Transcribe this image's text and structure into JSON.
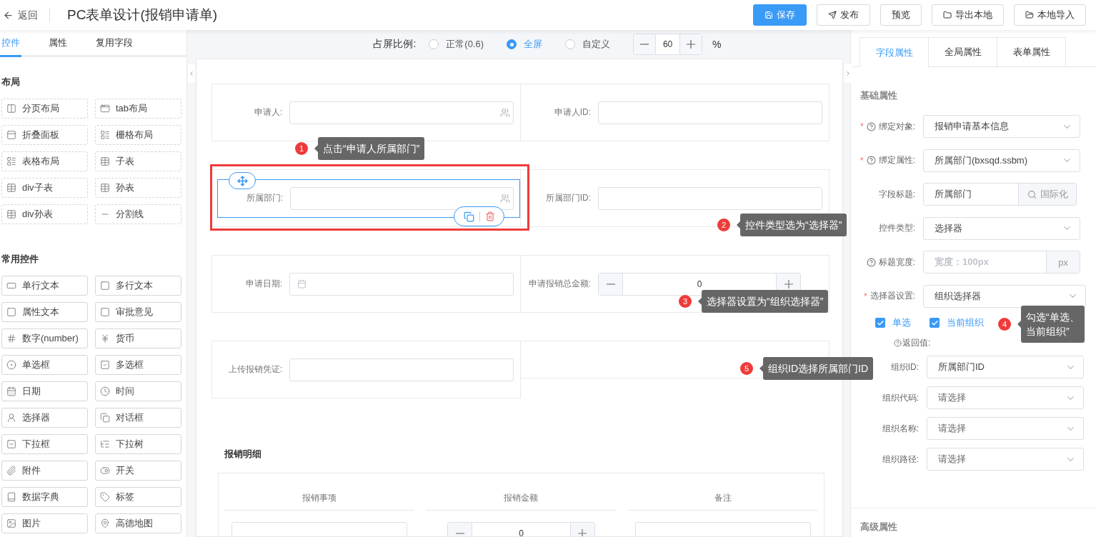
{
  "header": {
    "back": "返回",
    "title": "PC表单设计(报销申请单)",
    "buttons": [
      {
        "label": "保存",
        "kind": "primary"
      },
      {
        "label": "发布",
        "kind": "publish"
      },
      {
        "label": "预览",
        "kind": "plain"
      },
      {
        "label": "导出本地",
        "kind": "export"
      },
      {
        "label": "本地导入",
        "kind": "import"
      }
    ]
  },
  "left_panel": {
    "tabs": [
      {
        "label": "控件",
        "selected": true
      },
      {
        "label": "属性",
        "selected": false
      },
      {
        "label": "复用字段",
        "selected": false
      }
    ],
    "sections": [
      {
        "title": "布局",
        "kind": "layout",
        "items": [
          "分页布局",
          "tab布局",
          "折叠面板",
          "栅格布局",
          "表格布局",
          "子表",
          "div子表",
          "孙表",
          "div孙表",
          "分割线"
        ]
      },
      {
        "title": "常用控件",
        "kind": "common",
        "items": [
          "单行文本",
          "多行文本",
          "属性文本",
          "审批意见",
          "数字(number)",
          "货币",
          "单选框",
          "多选框",
          "日期",
          "时间",
          "选择器",
          "对话框",
          "下拉框",
          "下拉树",
          "附件",
          "开关",
          "数据字典",
          "标签",
          "图片",
          "高德地图"
        ]
      }
    ]
  },
  "ratio_bar": {
    "label": "占屏比例:",
    "options": [
      {
        "label": "正常(0.6)",
        "selected": false
      },
      {
        "label": "全屏",
        "selected": true
      },
      {
        "label": "自定义",
        "selected": false
      }
    ],
    "value": "60",
    "unit": "%"
  },
  "form": {
    "rows": [
      {
        "selected": false,
        "cells": [
          {
            "label": "申请人:",
            "kind": "user"
          },
          {
            "label": "申请人ID:",
            "kind": "text"
          }
        ]
      },
      {
        "selected": true,
        "cells": [
          {
            "label": "所属部门:",
            "kind": "user"
          },
          {
            "label": "所属部门ID:",
            "kind": "text"
          }
        ]
      },
      {
        "selected": false,
        "cells": [
          {
            "label": "申请日期:",
            "kind": "date"
          },
          {
            "label": "申请报销总金额:",
            "kind": "number",
            "value": "0"
          }
        ]
      },
      {
        "selected": false,
        "cells": [
          {
            "label": "上传报销凭证:",
            "kind": "text"
          },
          {
            "kind": "empty"
          }
        ]
      }
    ],
    "detail": {
      "title": "报销明细",
      "columns": [
        "报销事项",
        "报销金额",
        "备注"
      ],
      "cells": [
        {
          "kind": "text"
        },
        {
          "kind": "number",
          "value": "0"
        },
        {
          "kind": "text"
        }
      ]
    }
  },
  "annotations": [
    {
      "number": "1",
      "lines": [
        "点击“申请人所属部门”"
      ]
    },
    {
      "number": "2",
      "lines": [
        "控件类型选为“选择器”"
      ]
    },
    {
      "number": "3",
      "lines": [
        "选择器设置为“组织选择器”"
      ]
    },
    {
      "number": "4",
      "lines": [
        "勾选“单选、",
        "当前组织”"
      ]
    },
    {
      "number": "5",
      "lines": [
        "组织ID选择所属部门ID"
      ]
    }
  ],
  "right_panel": {
    "tabs": [
      {
        "label": "字段属性",
        "selected": true
      },
      {
        "label": "全局属性",
        "selected": false
      },
      {
        "label": "表单属性",
        "selected": false
      }
    ],
    "section": "基础属性",
    "fields": [
      {
        "label": "绑定对象:",
        "marker": "*",
        "help": true,
        "kind": "select",
        "value": "报销申请基本信息"
      },
      {
        "label": "绑定属性:",
        "marker": "*",
        "help": true,
        "kind": "select",
        "value": "所属部门(bxsqd.ssbm)"
      },
      {
        "label": "字段标题:",
        "help": false,
        "kind": "search-addon",
        "value": "所属部门",
        "addon": "国际化"
      },
      {
        "label": "控件类型:",
        "help": false,
        "kind": "select",
        "value": "选择器"
      },
      {
        "label": "标题宽度:",
        "help": true,
        "kind": "unit",
        "placeholder": "宽度：100px",
        "addon": "px"
      },
      {
        "label": "选择器设置:",
        "marker": "*",
        "help": false,
        "kind": "select",
        "value": "组织选择器"
      }
    ],
    "checkboxes": [
      {
        "label": "单选",
        "checked": true
      },
      {
        "label": "当前组织",
        "checked": true
      }
    ],
    "return_label": "返回值:",
    "return_fields": [
      {
        "label": "组织ID:",
        "value": "所属部门ID"
      },
      {
        "label": "组织代码:",
        "placeholder": "请选择"
      },
      {
        "label": "组织名称:",
        "placeholder": "请选择"
      },
      {
        "label": "组织路径:",
        "placeholder": "请选择"
      }
    ],
    "advanced": "高级属性"
  }
}
